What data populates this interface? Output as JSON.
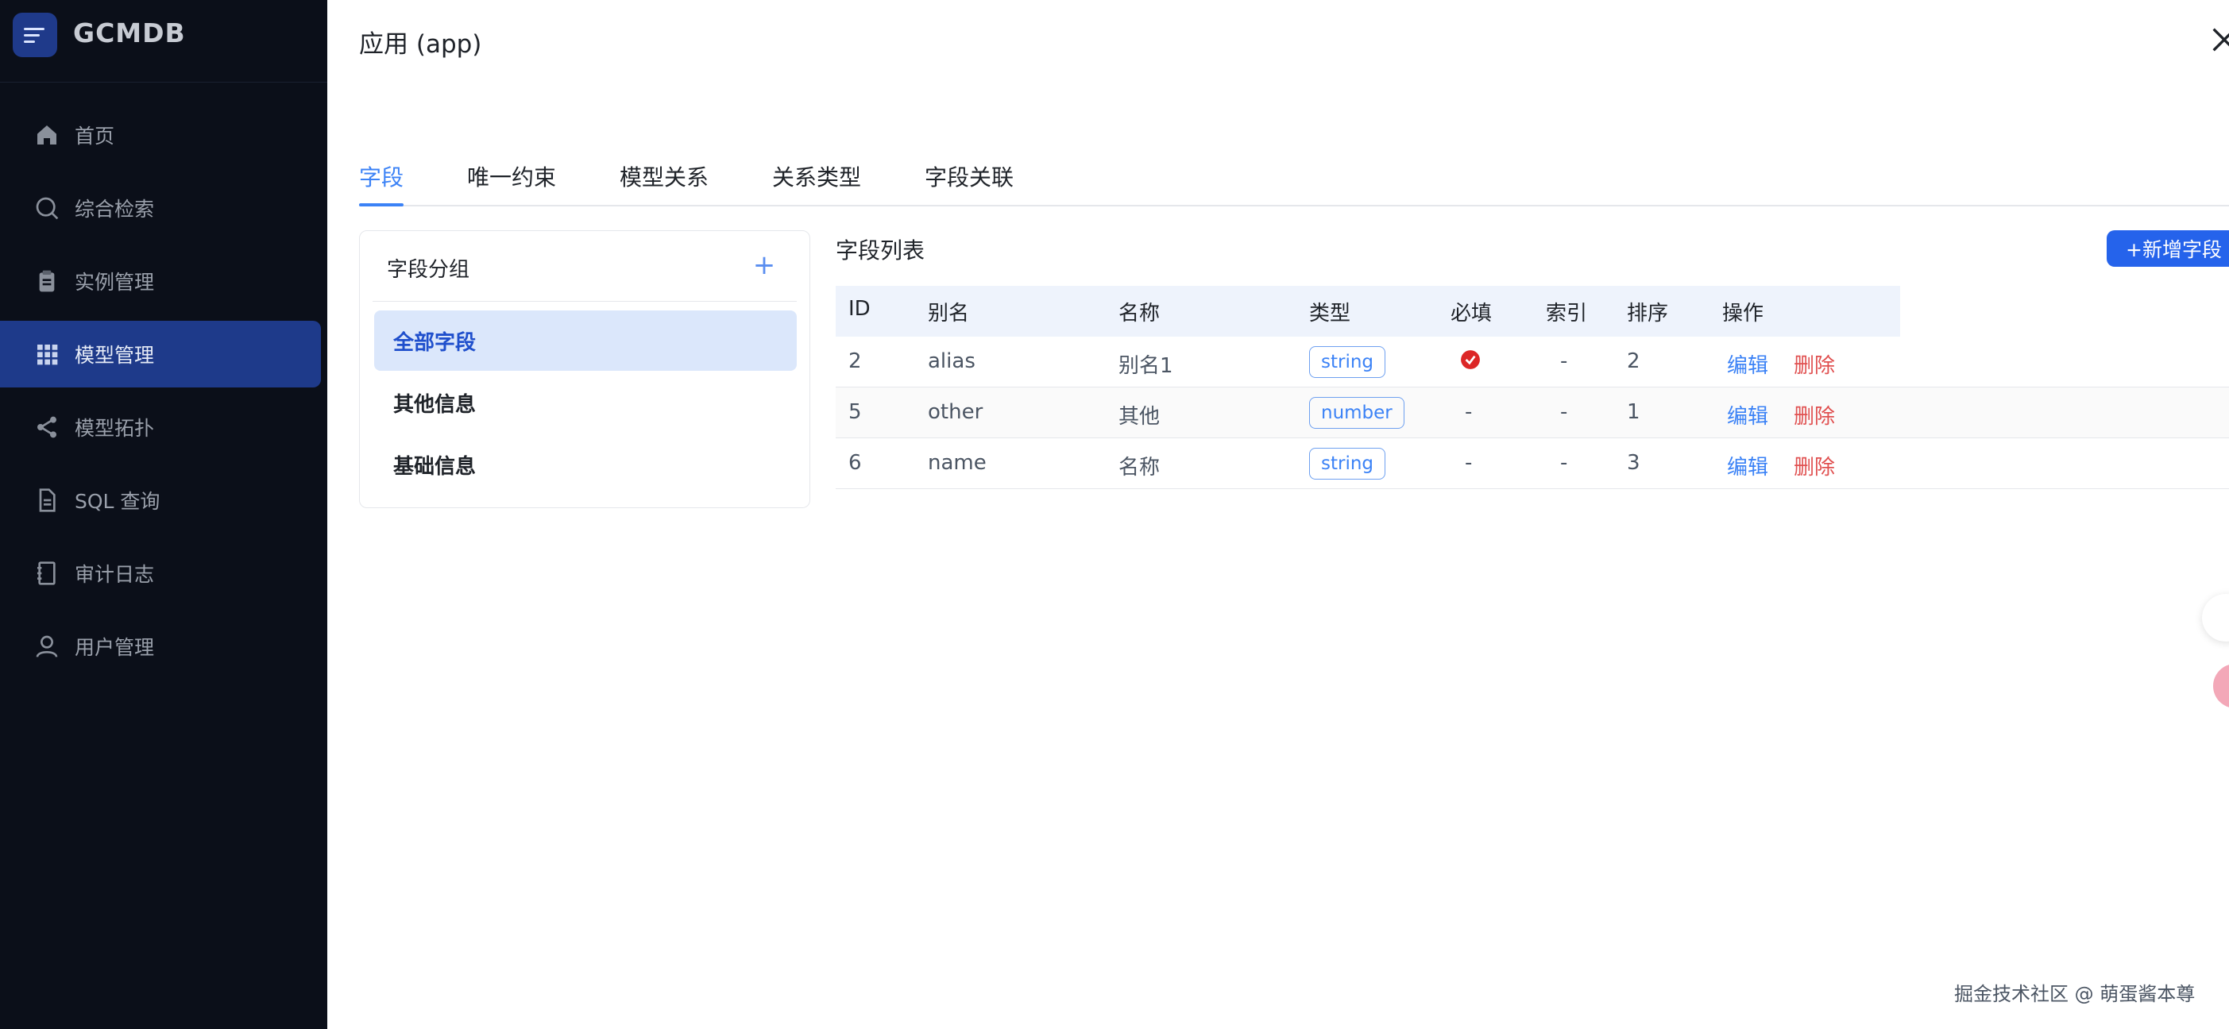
{
  "brand": {
    "title": "GCMDB"
  },
  "nav": [
    {
      "label": "首页",
      "icon": "home-icon"
    },
    {
      "label": "综合检索",
      "icon": "search-icon"
    },
    {
      "label": "实例管理",
      "icon": "clipboard-icon"
    },
    {
      "label": "模型管理",
      "icon": "grid-icon",
      "active": true
    },
    {
      "label": "模型拓扑",
      "icon": "share-icon"
    },
    {
      "label": "SQL 查询",
      "icon": "document-icon"
    },
    {
      "label": "审计日志",
      "icon": "notebook-icon"
    },
    {
      "label": "用户管理",
      "icon": "user-icon"
    }
  ],
  "header": {
    "title": "应用 (app)"
  },
  "tabs": [
    {
      "label": "字段",
      "active": true
    },
    {
      "label": "唯一约束"
    },
    {
      "label": "模型关系"
    },
    {
      "label": "关系类型"
    },
    {
      "label": "字段关联"
    }
  ],
  "groups": {
    "title": "字段分组",
    "add_symbol": "+",
    "items": [
      {
        "label": "全部字段",
        "active": true
      },
      {
        "label": "其他信息"
      },
      {
        "label": "基础信息"
      }
    ]
  },
  "field_list": {
    "title": "字段列表",
    "add_button": "+新增字段",
    "columns": [
      "ID",
      "别名",
      "名称",
      "类型",
      "必填",
      "索引",
      "排序",
      "操作"
    ],
    "rows": [
      {
        "id": "2",
        "alias": "alias",
        "name": "别名1",
        "type": "string",
        "required": "check",
        "index": "-",
        "order": "2",
        "edit": "编辑",
        "delete": "删除"
      },
      {
        "id": "5",
        "alias": "other",
        "name": "其他",
        "type": "number",
        "required": "-",
        "index": "-",
        "order": "1",
        "edit": "编辑",
        "delete": "删除"
      },
      {
        "id": "6",
        "alias": "name",
        "name": "名称",
        "type": "string",
        "required": "-",
        "index": "-",
        "order": "3",
        "edit": "编辑",
        "delete": "删除"
      }
    ]
  },
  "watermark": "掘金技术社区 @ 萌蛋酱本尊",
  "colors": {
    "sidebar_bg": "#0b0f19",
    "accent": "#3b82f6",
    "nav_active": "#1e3a8a",
    "danger": "#e05050",
    "check": "#dc2626"
  }
}
